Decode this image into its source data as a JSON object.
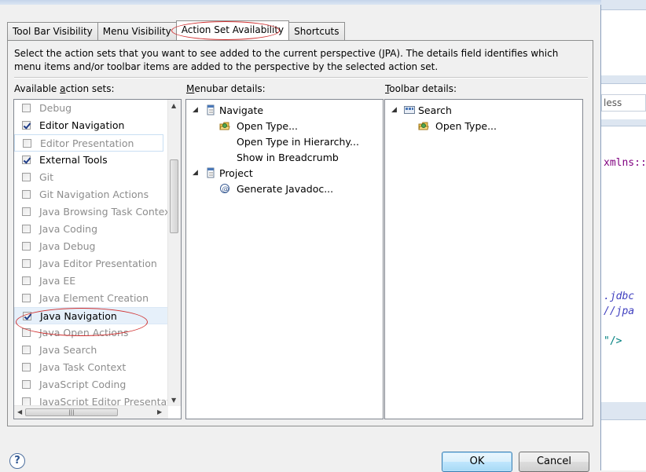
{
  "background_editor": {
    "search_fragment": "less",
    "code_lines": [
      "xmlns::",
      ".jdbc",
      "//jpa",
      "\"/>"
    ]
  },
  "tabs": [
    {
      "label": "Tool Bar Visibility"
    },
    {
      "label": "Menu Visibility"
    },
    {
      "label": "Action Set Availability",
      "active": true
    },
    {
      "label": "Shortcuts"
    }
  ],
  "description": "Select the action sets that you want to see added to the current perspective (JPA).  The details field identifies which menu items and/or toolbar items are added to the perspective by the selected action set.",
  "available_label": {
    "pre": "Available ",
    "mnemonic": "a",
    "post": "ction sets:"
  },
  "menubar_label": {
    "pre": "",
    "mnemonic": "M",
    "post": "enubar details:"
  },
  "toolbar_label": {
    "pre": "",
    "mnemonic": "T",
    "post": "oolbar details:"
  },
  "action_sets": [
    {
      "label": "Debug",
      "checked": false,
      "enabled": false
    },
    {
      "label": "Editor Navigation",
      "checked": true,
      "enabled": true
    },
    {
      "label": "Editor Presentation",
      "checked": false,
      "enabled": false
    },
    {
      "label": "External Tools",
      "checked": true,
      "enabled": true
    },
    {
      "label": "Git",
      "checked": false,
      "enabled": false
    },
    {
      "label": "Git Navigation Actions",
      "checked": false,
      "enabled": false
    },
    {
      "label": "Java Browsing Task Context",
      "checked": false,
      "enabled": false
    },
    {
      "label": "Java Coding",
      "checked": false,
      "enabled": false
    },
    {
      "label": "Java Debug",
      "checked": false,
      "enabled": false
    },
    {
      "label": "Java Editor Presentation",
      "checked": false,
      "enabled": false
    },
    {
      "label": "Java EE",
      "checked": false,
      "enabled": false
    },
    {
      "label": "Java Element Creation",
      "checked": false,
      "enabled": false
    },
    {
      "label": "Java Navigation",
      "checked": true,
      "enabled": true,
      "selected": true
    },
    {
      "label": "Java Open Actions",
      "checked": false,
      "enabled": false
    },
    {
      "label": "Java Search",
      "checked": false,
      "enabled": false
    },
    {
      "label": "Java Task Context",
      "checked": false,
      "enabled": false
    },
    {
      "label": "JavaScript Coding",
      "checked": false,
      "enabled": false
    },
    {
      "label": "JavaScript Editor Presentatio",
      "checked": false,
      "enabled": false
    }
  ],
  "menubar_details": [
    {
      "label": "Navigate",
      "icon": "menu-icon",
      "level": 0,
      "expanded": true
    },
    {
      "label": "Open Type...",
      "icon": "open-type-icon",
      "level": 1
    },
    {
      "label": "Open Type in Hierarchy...",
      "icon": "",
      "level": 1
    },
    {
      "label": "Show in Breadcrumb",
      "icon": "",
      "level": 1
    },
    {
      "label": "Project",
      "icon": "menu-icon",
      "level": 0,
      "expanded": true
    },
    {
      "label": "Generate Javadoc...",
      "icon": "javadoc-icon",
      "level": 1
    }
  ],
  "toolbar_details": [
    {
      "label": "Search",
      "icon": "toolbar-icon",
      "level": 0,
      "expanded": true
    },
    {
      "label": "Open Type...",
      "icon": "open-type-icon",
      "level": 1
    }
  ],
  "buttons": {
    "help": "?",
    "ok": "OK",
    "cancel": "Cancel"
  }
}
